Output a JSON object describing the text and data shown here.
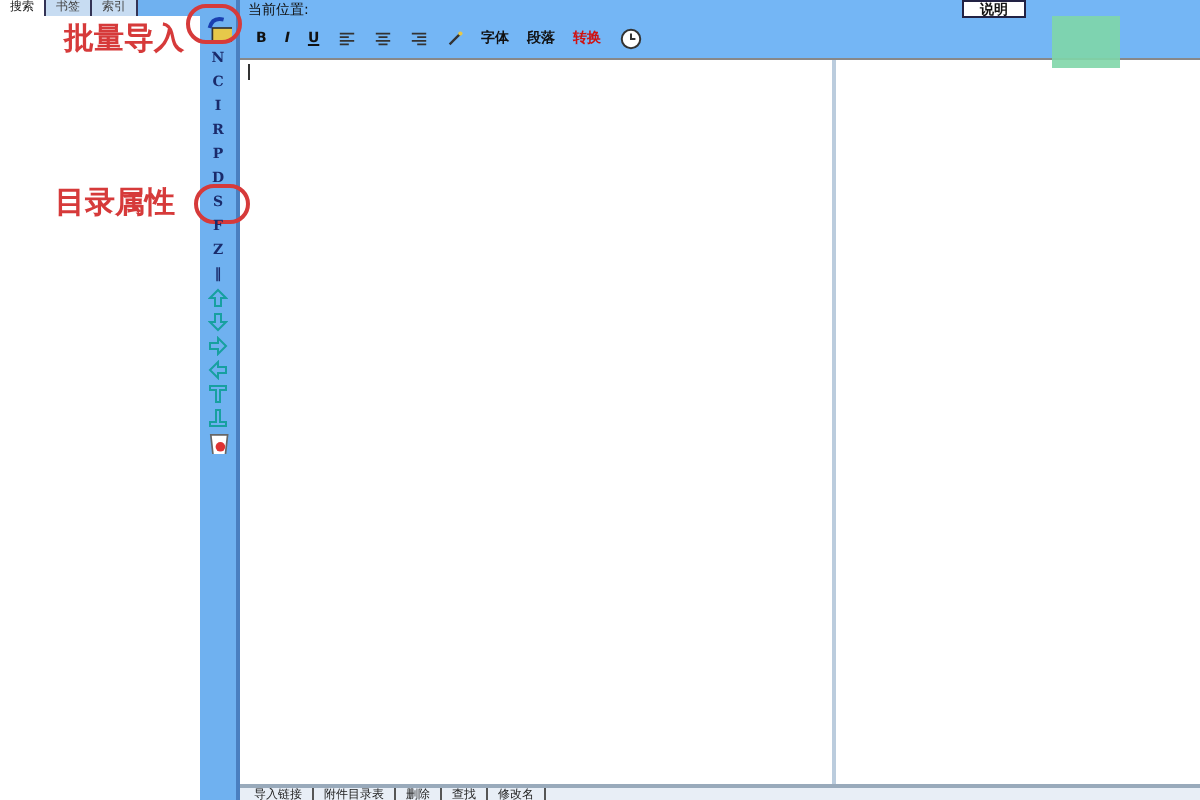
{
  "left_tabs": [
    {
      "label": "搜索",
      "selected": true
    },
    {
      "label": "书签",
      "selected": false
    },
    {
      "label": "索引",
      "selected": false
    }
  ],
  "annotations": [
    {
      "text": "批量导入"
    },
    {
      "text": "目录属性"
    }
  ],
  "side_toolbar": [
    {
      "kind": "icon"
    },
    {
      "kind": "text",
      "label": "N"
    },
    {
      "kind": "text",
      "label": "C"
    },
    {
      "kind": "text",
      "label": "I"
    },
    {
      "kind": "text",
      "label": "R"
    },
    {
      "kind": "text",
      "label": "P"
    },
    {
      "kind": "text",
      "label": "D"
    },
    {
      "kind": "text",
      "label": "S"
    },
    {
      "kind": "text",
      "label": "F"
    },
    {
      "kind": "text",
      "label": "Z"
    },
    {
      "kind": "text",
      "label": "‖"
    },
    {
      "kind": "icon"
    },
    {
      "kind": "icon"
    },
    {
      "kind": "icon"
    },
    {
      "kind": "icon"
    },
    {
      "kind": "icon"
    },
    {
      "kind": "icon"
    },
    {
      "kind": "icon"
    }
  ],
  "location_label": "当前位置:",
  "help_button": "说明",
  "format_toolbar": [
    {
      "kind": "text",
      "label": "B"
    },
    {
      "kind": "text",
      "label": "I"
    },
    {
      "kind": "text",
      "label": "U"
    },
    {
      "kind": "icon"
    },
    {
      "kind": "icon"
    },
    {
      "kind": "icon"
    },
    {
      "kind": "icon"
    },
    {
      "kind": "text",
      "label": "字体"
    },
    {
      "kind": "text",
      "label": "段落"
    },
    {
      "kind": "text",
      "label": "转换"
    },
    {
      "kind": "icon"
    }
  ],
  "bottom_tabs": [
    {
      "label": "导入链接"
    },
    {
      "label": "附件目录表"
    },
    {
      "label": "删除"
    },
    {
      "label": "查找"
    },
    {
      "label": "修改名"
    }
  ]
}
